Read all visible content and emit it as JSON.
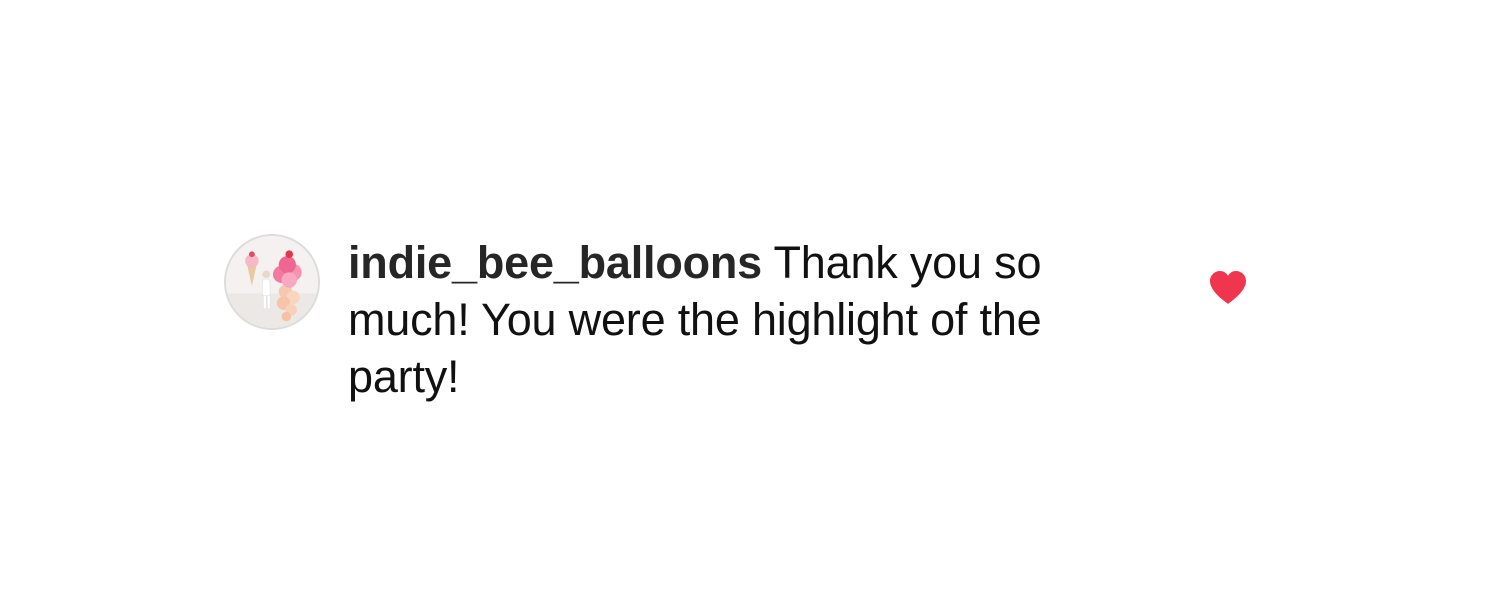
{
  "comment": {
    "username": "indie_bee_balloons",
    "text": "Thank you so much! You were the highlight of the party!",
    "avatar_icon": "profile-photo-balloon-ice-cream",
    "like_icon": "heart-icon",
    "liked": true,
    "like_color": "#f0354f"
  }
}
